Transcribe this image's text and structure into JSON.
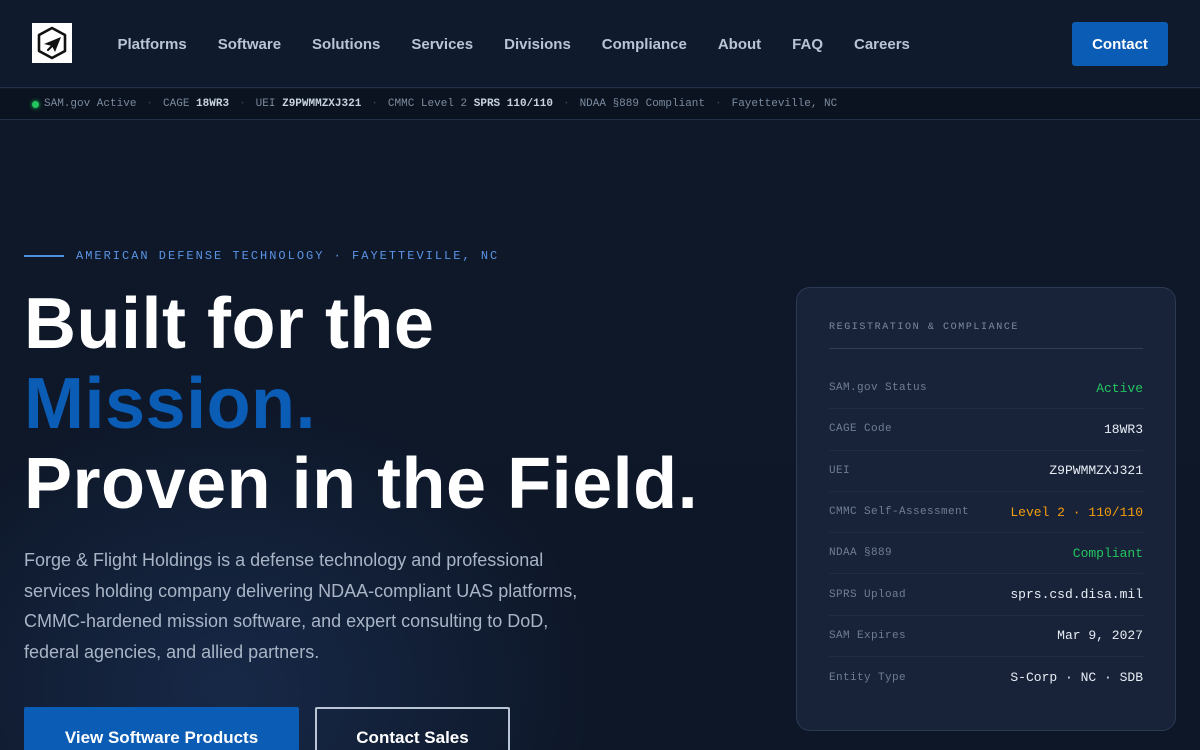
{
  "nav": {
    "logo_alt": "Forge & Flight Holdings logo",
    "links": [
      "Platforms",
      "Software",
      "Solutions",
      "Services",
      "Divisions",
      "Compliance",
      "About",
      "FAQ",
      "Careers"
    ],
    "contact_label": "Contact"
  },
  "status_strip": {
    "sam": "SAM.gov Active",
    "sep": "·",
    "cage_label": "CAGE",
    "cage_value": "18WR3",
    "uei_label": "UEI",
    "uei_value": "Z9PWMMZXJ321",
    "cmmc_label": "CMMC Level 2",
    "sprs_value": "SPRS 110/110",
    "ndaa": "NDAA §889 Compliant",
    "location": "Fayetteville, NC",
    "status_color": "#22c55e"
  },
  "hero": {
    "eyebrow": "AMERICAN DEFENSE TECHNOLOGY · FAYETTEVILLE, NC",
    "headline_line1": "Built for the",
    "headline_accent": "Mission.",
    "headline_line3": "Proven in the Field.",
    "lede": "Forge & Flight Holdings is a defense technology and professional services holding company delivering NDAA-compliant UAS platforms, CMMC-hardened mission software, and expert consulting to DoD, federal agencies, and allied partners.",
    "primary_cta": "View Software Products",
    "secondary_cta": "Contact Sales",
    "accent_color": "#0b5cb5"
  },
  "registration_card": {
    "title": "REGISTRATION & COMPLIANCE",
    "rows": [
      {
        "label": "SAM.gov Status",
        "value": "Active",
        "tone": "green"
      },
      {
        "label": "CAGE Code",
        "value": "18WR3",
        "tone": "default"
      },
      {
        "label": "UEI",
        "value": "Z9PWMMZXJ321",
        "tone": "default"
      },
      {
        "label": "CMMC Self-Assessment",
        "value": "Level 2 · 110/110",
        "tone": "amber"
      },
      {
        "label": "NDAA §889",
        "value": "Compliant",
        "tone": "green"
      },
      {
        "label": "SPRS Upload",
        "value": "sprs.csd.disa.mil",
        "tone": "default"
      },
      {
        "label": "SAM Expires",
        "value": "Mar 9, 2027",
        "tone": "default"
      },
      {
        "label": "Entity Type",
        "value": "S-Corp · NC · SDB",
        "tone": "default"
      }
    ]
  }
}
